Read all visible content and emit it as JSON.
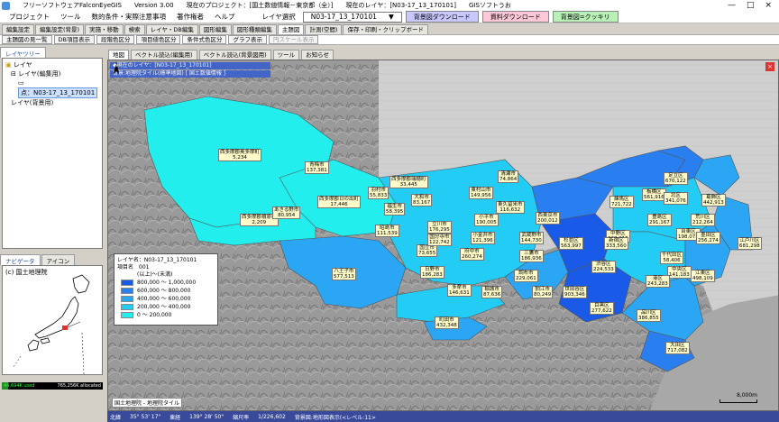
{
  "titlebar": {
    "app": "フリーソフトウェアFalconEyeGIS",
    "version": "Version 3.00",
    "project": "現在のプロジェクト：[国土数値情報－東京都（全）]",
    "current_layer": "現在のレイヤ：[N03-17_13_170101]",
    "gis_software": "GISソフトうお",
    "min": "—",
    "max": "□",
    "close": "×"
  },
  "menubar": {
    "items": [
      "プロジェクト",
      "ツール",
      "数的条件・実際注意事項",
      "著作権者",
      "ヘルプ"
    ],
    "layer_select_label": "レイヤ選択",
    "layer_select_value": "N03-17_13_170101",
    "btn_bg_download": "背景図ダウンロード",
    "btn_data_download": "資料ダウンロード",
    "btn_bg_clear": "背景図=クッキリ"
  },
  "tabs1": [
    "編集設定",
    "編集設定(背景)",
    "実施・移動",
    "検索",
    "レイヤ・DB編集",
    "図形編集",
    "図形種類編集",
    "主題図",
    "計測(空間)",
    "保存・印刷・クリップボード"
  ],
  "tabs2": [
    {
      "label": "主題図の見一覧",
      "disabled": false
    },
    {
      "label": "DB項目表示",
      "disabled": false
    },
    {
      "label": "段階色区分",
      "disabled": false
    },
    {
      "label": "項目値色区分",
      "disabled": false
    },
    {
      "label": "条件式色区分",
      "disabled": false
    },
    {
      "label": "グラフ表示",
      "disabled": false
    },
    {
      "label": "円スケール表示",
      "disabled": true
    }
  ],
  "left_panel": {
    "tabs": [
      "レイヤツリー"
    ],
    "tree": {
      "root": "レイヤ",
      "group1": "レイヤ(編集用)",
      "selected": "点：N03-17_13_170101",
      "group2": "レイヤ(背景用)"
    }
  },
  "nav_panel": {
    "tabs": [
      "ナビゲータ",
      "アイコン"
    ],
    "credit": "(c) 国土地理院"
  },
  "memory": {
    "used": "44,694K used",
    "allocated": "765,256K allocated",
    "ratio": 0.06
  },
  "map_tabs": [
    "地図",
    "ベクトル読込(編集用)",
    "ベクトル読込(背景図用)",
    "ツール",
    "お知らせ"
  ],
  "map": {
    "current_layer_lines": [
      "◆現在のレイヤ：[N03-17_13_170101]",
      "背景:地理院タイル(標準地図) [ 国土数値情報 ]"
    ],
    "close": "×",
    "credit": "国土地理院 - 地理院タイル",
    "scale": "8,000m",
    "north": "N"
  },
  "legend": {
    "title": "レイヤ名：N03-17_13_170101",
    "item_label": "項目名",
    "item_value": "001",
    "unit": "(以上)〜(未満)",
    "ranges": [
      {
        "label": "800,000 ～ 1,000,000",
        "color": "#1a5ae8"
      },
      {
        "label": "600,000 ～ 800,000",
        "color": "#2a7ff0"
      },
      {
        "label": "400,000 ～ 600,000",
        "color": "#2aa6f5"
      },
      {
        "label": "200,000 ～ 400,000",
        "color": "#22ccf5"
      },
      {
        "label": "0 ～ 200,000",
        "color": "#22eeee"
      }
    ]
  },
  "regions": [
    {
      "name": "西多摩郡奥多摩町",
      "value": "5,234"
    },
    {
      "name": "青梅市",
      "value": "137,381"
    },
    {
      "name": "西多摩郡檜原村",
      "value": "2,209"
    },
    {
      "name": "あきる野市",
      "value": "80,954"
    },
    {
      "name": "西多摩郡日の出町",
      "value": "17,446"
    },
    {
      "name": "羽村市",
      "value": "55,833"
    },
    {
      "name": "西多摩郡瑞穂町",
      "value": "33,445"
    },
    {
      "name": "福生市",
      "value": "58,395"
    },
    {
      "name": "昭島市",
      "value": "111,539"
    },
    {
      "name": "八王子市",
      "value": "577,513"
    },
    {
      "name": "日野市",
      "value": "186,283"
    },
    {
      "name": "立川市",
      "value": "176,295"
    },
    {
      "name": "国立市",
      "value": "73,655"
    },
    {
      "name": "東村山市",
      "value": "149,956"
    },
    {
      "name": "大和市",
      "value": "83,167"
    },
    {
      "name": "清瀬市",
      "value": "74,864"
    },
    {
      "name": "東久留米市",
      "value": "116,632"
    },
    {
      "name": "西東京市",
      "value": "200,012"
    },
    {
      "name": "小平市",
      "value": "190,005"
    },
    {
      "name": "国分寺市",
      "value": "122,742"
    },
    {
      "name": "小金井市",
      "value": "121,396"
    },
    {
      "name": "府中市",
      "value": "260,274"
    },
    {
      "name": "武蔵野市",
      "value": "144,730"
    },
    {
      "name": "三鷹市",
      "value": "186,936"
    },
    {
      "name": "調布市",
      "value": "229,061"
    },
    {
      "name": "狛江市",
      "value": "80,249"
    },
    {
      "name": "多摩市",
      "value": "146,631"
    },
    {
      "name": "稲城市",
      "value": "87,636"
    },
    {
      "name": "町田市",
      "value": "432,348"
    },
    {
      "name": "足立区",
      "value": "670,122"
    },
    {
      "name": "葛飾区",
      "value": "442,913"
    },
    {
      "name": "練馬区",
      "value": "721,722"
    },
    {
      "name": "板橋区",
      "value": "561,916"
    },
    {
      "name": "北区",
      "value": "341,076"
    },
    {
      "name": "荒川区",
      "value": "212,264"
    },
    {
      "name": "豊島区",
      "value": "291,167"
    },
    {
      "name": "台東区",
      "value": "198,073"
    },
    {
      "name": "墨田区",
      "value": "256,274"
    },
    {
      "name": "江戸川区",
      "value": "681,298"
    },
    {
      "name": "中野区",
      "value": "328,215"
    },
    {
      "name": "杉並区",
      "value": "563,997"
    },
    {
      "name": "新宿区",
      "value": "333,560"
    },
    {
      "name": "千代田区",
      "value": "58,406"
    },
    {
      "name": "中央区",
      "value": "141,183"
    },
    {
      "name": "渋谷区",
      "value": "224,533"
    },
    {
      "name": "港区",
      "value": "243,283"
    },
    {
      "name": "江東区",
      "value": "498,109"
    },
    {
      "name": "世田谷区",
      "value": "903,346"
    },
    {
      "name": "目黒区",
      "value": "277,622"
    },
    {
      "name": "品川区",
      "value": "386,855"
    },
    {
      "name": "大田区",
      "value": "717,082"
    }
  ],
  "statusbar": {
    "coord_label": "北緯",
    "lat": "35° 53' 17\"",
    "lon_label": "東経",
    "lon": "139° 28' 50\"",
    "scale_label": "縮尺率",
    "scale": "1/226,602",
    "mode": "背景図:地形図表示(<レベル:11>"
  }
}
